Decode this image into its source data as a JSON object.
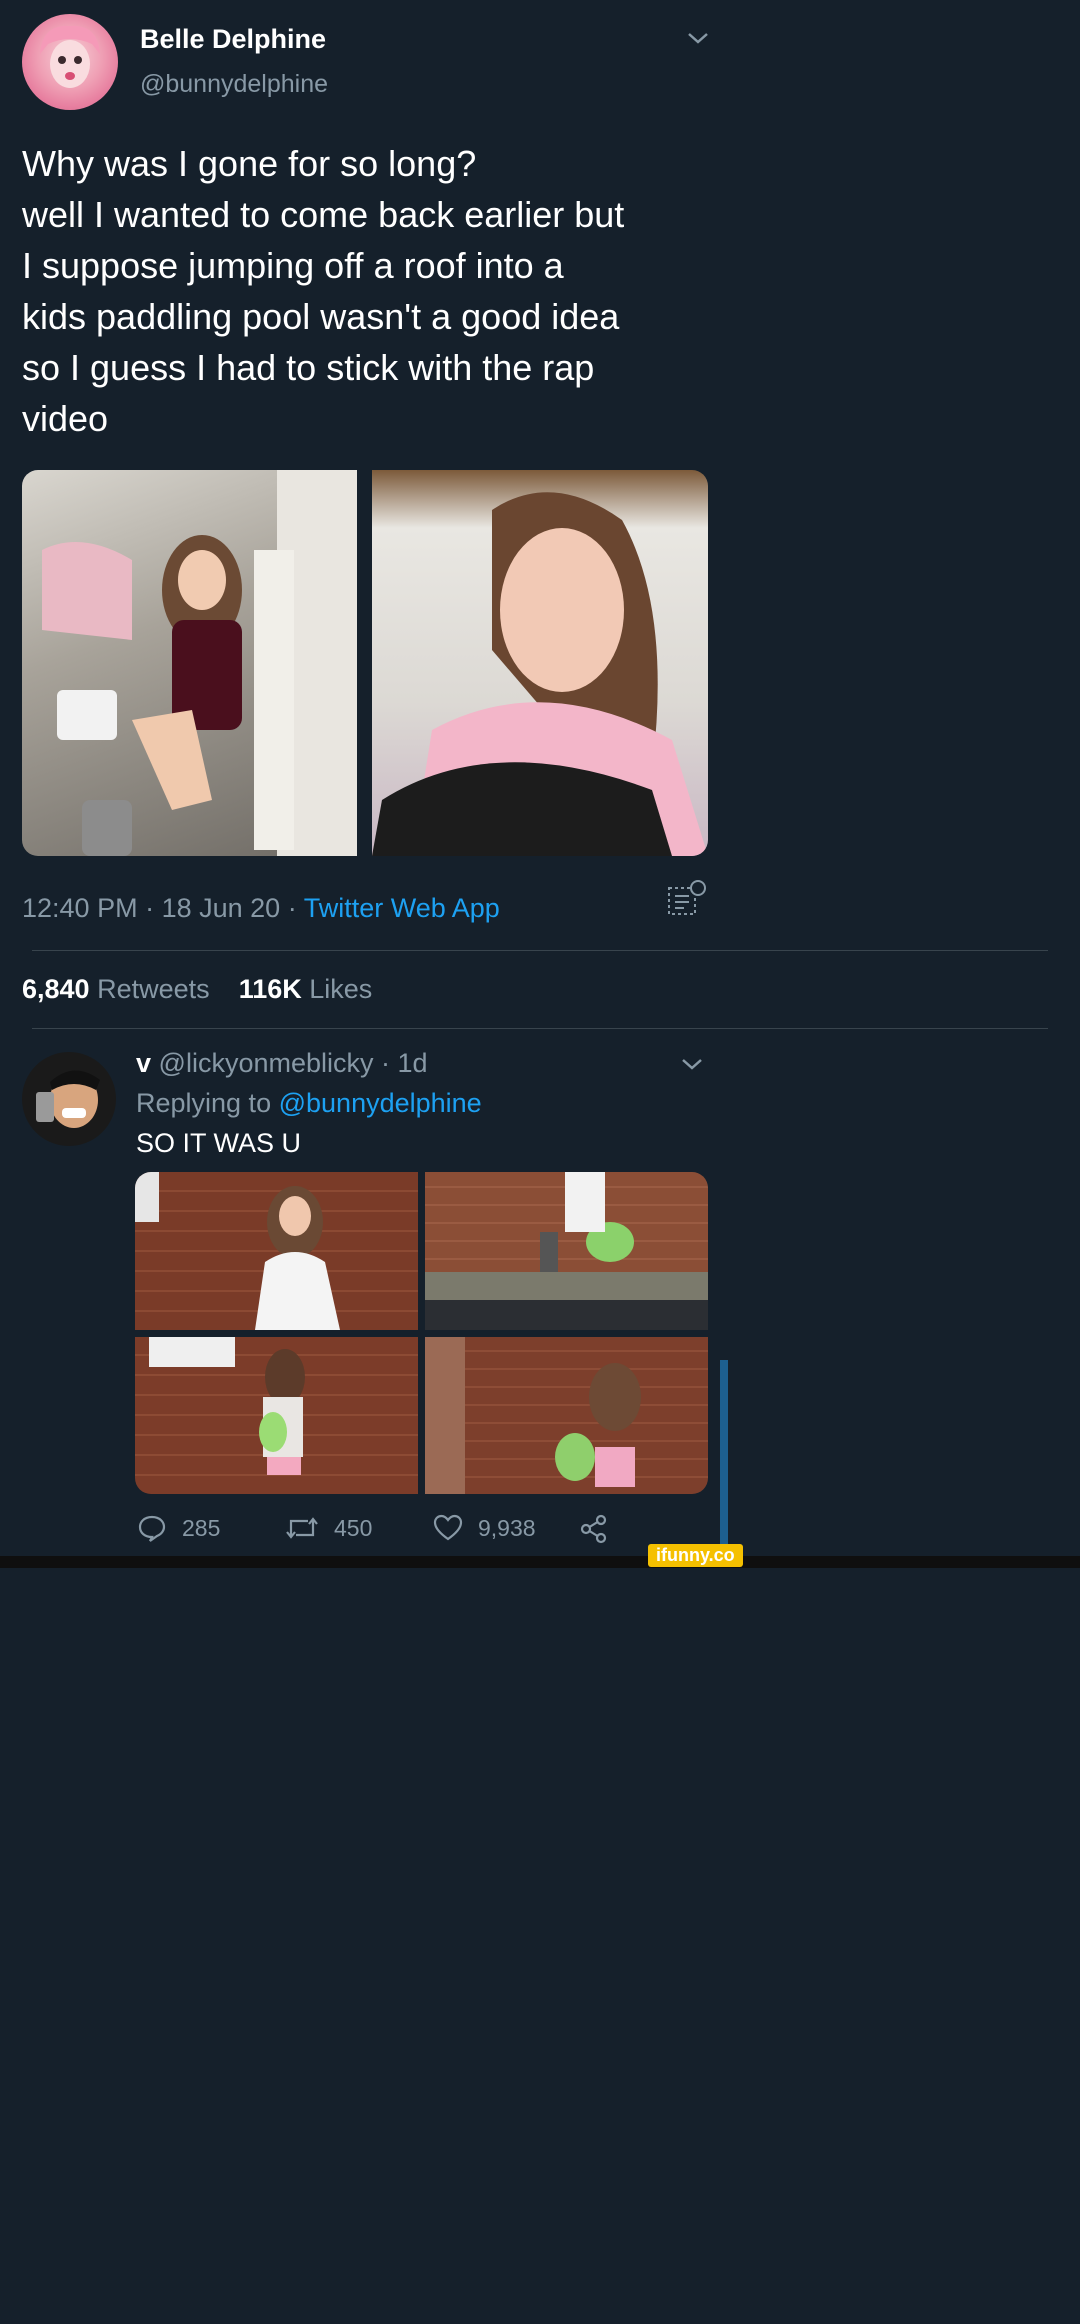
{
  "tweet": {
    "author_name": "Belle Delphine",
    "author_handle": "@bunnydelphine",
    "body_lines": [
      "Why was I gone for so long?",
      "well I wanted to come back earlier but",
      "I suppose jumping off a roof into a",
      "kids paddling pool wasn't a good idea",
      "so I guess I had to stick with the rap",
      "video"
    ],
    "time": "12:40 PM",
    "date": "18 Jun 20",
    "source": "Twitter Web App",
    "sep": " · ",
    "retweets_count": "6,840",
    "retweets_label": "Retweets",
    "likes_count": "116K",
    "likes_label": "Likes"
  },
  "reply": {
    "author_name": "v",
    "author_handle": "@lickyonmeblicky",
    "age": "1d",
    "replying_prefix": "Replying to",
    "replying_handle": "@bunnydelphine",
    "text": "SO IT WAS U",
    "reply_count": "285",
    "retweet_count": "450",
    "like_count": "9,938"
  },
  "watermark": "ifunny.co",
  "colors": {
    "background": "#15202b",
    "accent": "#1da1f2",
    "muted": "#8899a6",
    "divider": "#38444d",
    "watermark_bg": "#f5c000"
  }
}
